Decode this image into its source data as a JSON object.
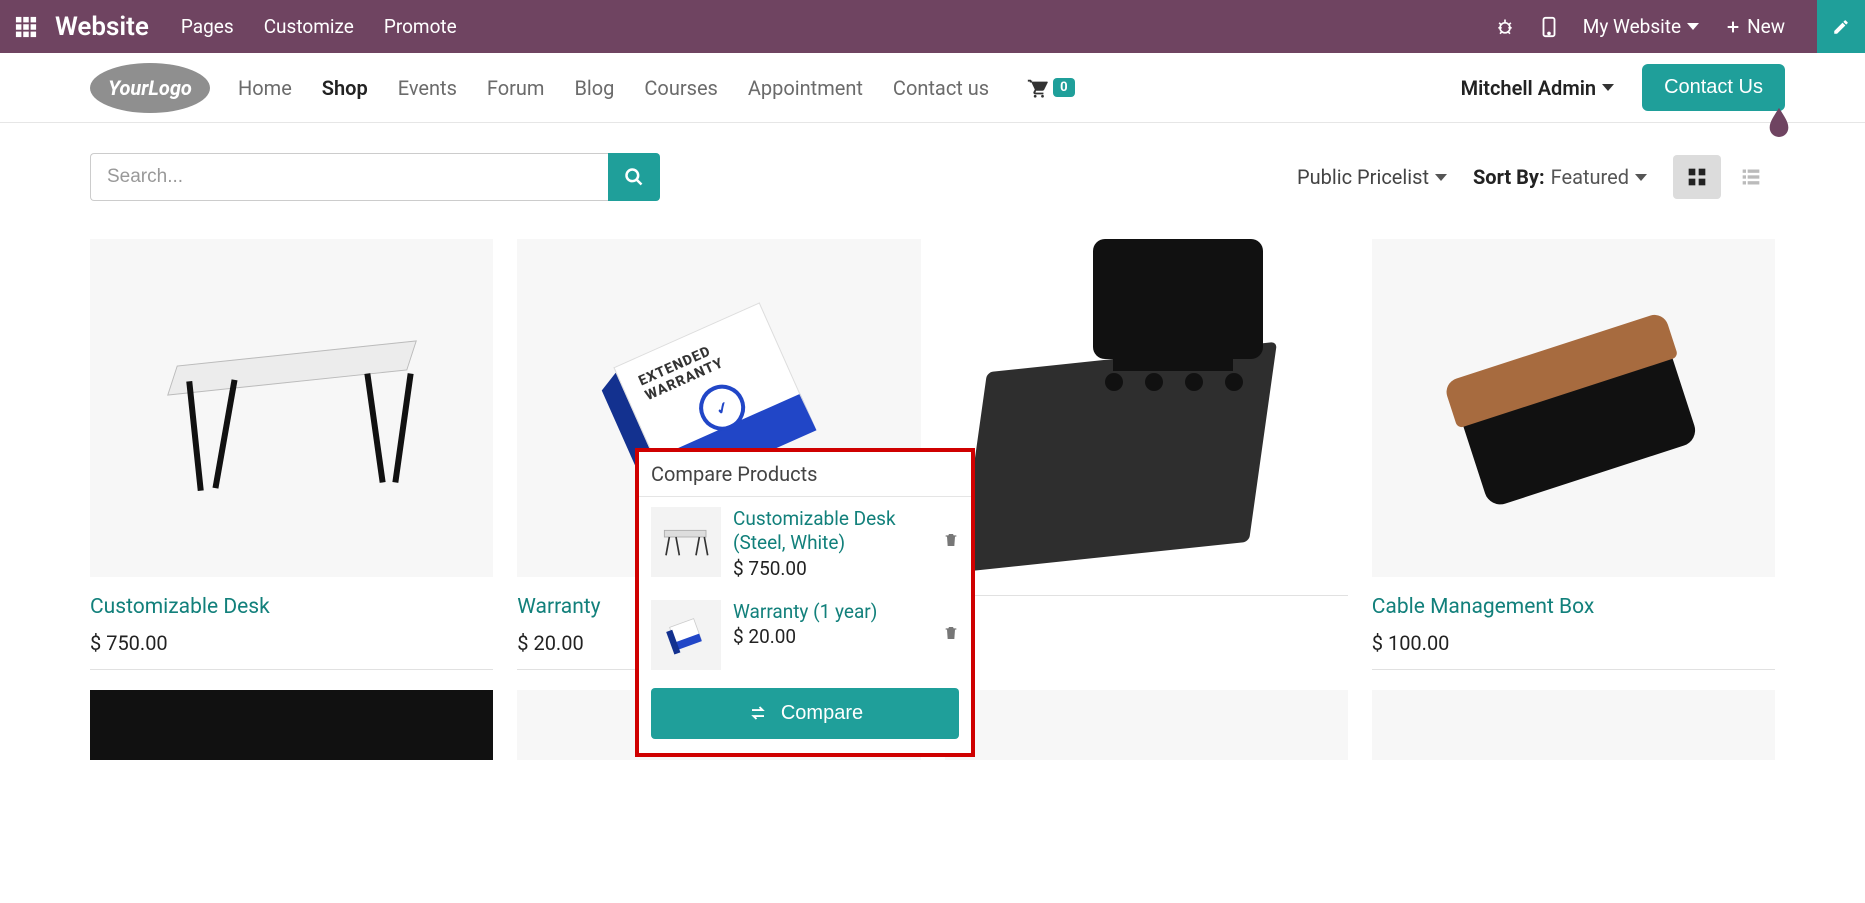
{
  "topbar": {
    "brand": "Website",
    "links": [
      "Pages",
      "Customize",
      "Promote"
    ],
    "mywebsite": "My Website",
    "new": "New"
  },
  "header": {
    "logo_your": "Your",
    "logo_logo": "Logo",
    "nav": [
      "Home",
      "Shop",
      "Events",
      "Forum",
      "Blog",
      "Courses",
      "Appointment",
      "Contact us"
    ],
    "active_nav_index": 1,
    "cart_count": "0",
    "user": "Mitchell Admin",
    "contact_btn": "Contact Us"
  },
  "toolbar": {
    "search_placeholder": "Search...",
    "pricelist": "Public Pricelist",
    "sort_label": "Sort By:",
    "sort_value": "Featured"
  },
  "products": [
    {
      "title": "Customizable Desk",
      "price": "$ 750.00"
    },
    {
      "title": "Warranty",
      "price": "$ 20.00"
    },
    {
      "title": "",
      "price": ""
    },
    {
      "title": "Cable Management Box",
      "price": "$ 100.00"
    }
  ],
  "warranty_box": {
    "line1": "EXTENDED",
    "line2": "WARRANTY"
  },
  "compare": {
    "header": "Compare Products",
    "items": [
      {
        "name": "Customizable Desk (Steel, White)",
        "price": "$ 750.00"
      },
      {
        "name": "Warranty (1 year)",
        "price": "$ 20.00"
      }
    ],
    "button": "Compare",
    "behind_label": "COMPARE"
  }
}
